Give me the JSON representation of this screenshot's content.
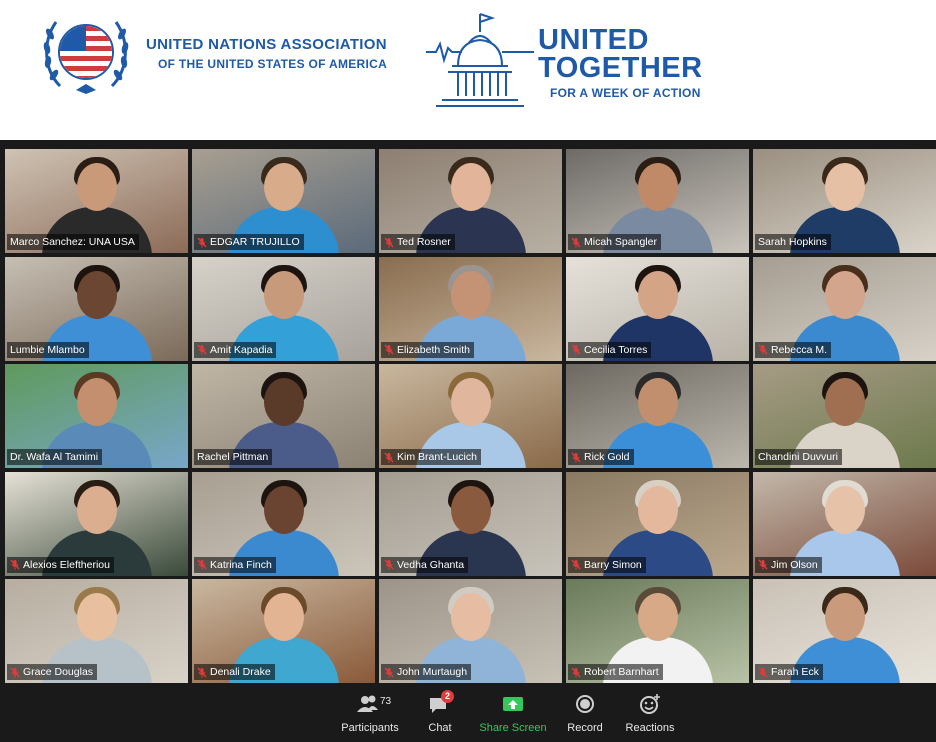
{
  "banner": {
    "org_line1": "UNITED NATIONS ASSOCIATION",
    "org_line2": "OF THE UNITED STATES OF AMERICA",
    "event_word1": "UNITED",
    "event_word2": "TOGETHER",
    "event_tagline": "FOR A WEEK OF ACTION",
    "brand_color": "#1e5aa8"
  },
  "meeting": {
    "active_speaker": "Marco Sanchez: UNA USA",
    "participants": [
      {
        "name": "Marco Sanchez: UNA USA",
        "muted": false
      },
      {
        "name": "EDGAR TRUJILLO",
        "muted": true
      },
      {
        "name": "Ted Rosner",
        "muted": true
      },
      {
        "name": "Micah Spangler",
        "muted": true
      },
      {
        "name": "Sarah Hopkins",
        "muted": false
      },
      {
        "name": "Lumbie Mlambo",
        "muted": false
      },
      {
        "name": "Amit Kapadia",
        "muted": true
      },
      {
        "name": "Elizabeth Smith",
        "muted": true
      },
      {
        "name": "Cecilia Torres",
        "muted": true
      },
      {
        "name": "Rebecca M.",
        "muted": true
      },
      {
        "name": "Dr. Wafa Al Tamimi",
        "muted": false
      },
      {
        "name": "Rachel Pittman",
        "muted": false
      },
      {
        "name": "Kim Brant-Lucich",
        "muted": true
      },
      {
        "name": "Rick Gold",
        "muted": true
      },
      {
        "name": "Chandini Duvvuri",
        "muted": false
      },
      {
        "name": "Alexios Eleftheriou",
        "muted": true
      },
      {
        "name": "Katrina Finch",
        "muted": true
      },
      {
        "name": "Vedha Ghanta",
        "muted": true
      },
      {
        "name": "Barry Simon",
        "muted": true
      },
      {
        "name": "Jim Olson",
        "muted": true
      },
      {
        "name": "Grace Douglas",
        "muted": true
      },
      {
        "name": "Denali Drake",
        "muted": true
      },
      {
        "name": "John Murtaugh",
        "muted": true
      },
      {
        "name": "Robert Barnhart",
        "muted": true
      },
      {
        "name": "Farah Eck",
        "muted": true
      }
    ]
  },
  "toolbar": {
    "participants_label": "Participants",
    "participants_count": "73",
    "chat_label": "Chat",
    "chat_badge": "2",
    "share_label": "Share Screen",
    "record_label": "Record",
    "reactions_label": "Reactions",
    "share_color": "#34c759",
    "badge_color": "#e03c3c"
  }
}
